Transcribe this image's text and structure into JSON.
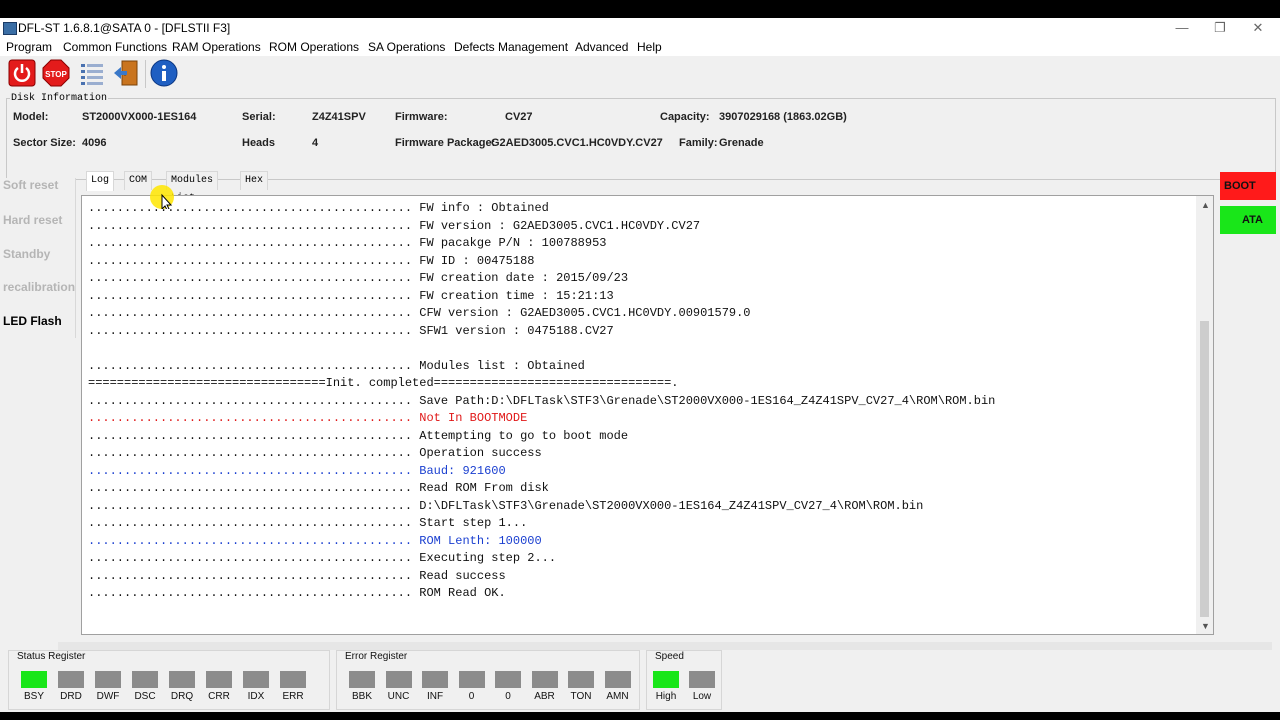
{
  "window": {
    "title": "DFL-ST 1.6.8.1@SATA 0 - [DFLSTII  F3]",
    "controls": {
      "minimize": "—",
      "restore": "❐",
      "close": "✕"
    }
  },
  "menu": [
    "Program",
    "Common Functions",
    "RAM Operations",
    "ROM Operations",
    "SA Operations",
    "Defects Management",
    "Advanced",
    "Help"
  ],
  "toolbar": {
    "icons": [
      "power-icon",
      "stop-icon",
      "list-icon",
      "exit-door-icon",
      "info-icon"
    ],
    "stop_text": "STOP"
  },
  "disk_info": {
    "legend": "Disk Information",
    "model_label": "Model:",
    "model_value": "ST2000VX000-1ES164",
    "serial_label": "Serial:",
    "serial_value": "Z4Z41SPV",
    "firmware_label": "Firmware:",
    "firmware_value": "CV27",
    "capacity_label": "Capacity:",
    "capacity_value": "3907029168 (1863.02GB)",
    "sector_label": "Sector Size:",
    "sector_value": "4096",
    "heads_label": "Heads",
    "heads_value": "4",
    "package_label": "Firmware Package:",
    "package_value": "G2AED3005.CVC1.HC0VDY.CV27",
    "family_label": "Family:",
    "family_value": "Grenade"
  },
  "left_panel": [
    {
      "label": "Soft reset",
      "enabled": false
    },
    {
      "label": "Hard reset",
      "enabled": false
    },
    {
      "label": "Standby",
      "enabled": false
    },
    {
      "label": "recalibration",
      "enabled": false
    },
    {
      "label": "LED Flash",
      "enabled": true
    }
  ],
  "tabs": [
    "Log",
    "COM",
    "Modules List",
    "Hex"
  ],
  "active_tab": "Log",
  "log_lines": [
    {
      "text": "............................................. FW info : Obtained",
      "color": "#111111"
    },
    {
      "text": "............................................. FW version : G2AED3005.CVC1.HC0VDY.CV27",
      "color": "#111111"
    },
    {
      "text": "............................................. FW pacakge P/N : 100788953",
      "color": "#111111"
    },
    {
      "text": "............................................. FW ID : 00475188",
      "color": "#111111"
    },
    {
      "text": "............................................. FW creation date : 2015/09/23",
      "color": "#111111"
    },
    {
      "text": "............................................. FW creation time : 15:21:13",
      "color": "#111111"
    },
    {
      "text": "............................................. CFW version : G2AED3005.CVC1.HC0VDY.00901579.0",
      "color": "#111111"
    },
    {
      "text": "............................................. SFW1 version : 0475188.CV27",
      "color": "#111111"
    },
    {
      "text": "",
      "color": "#111111"
    },
    {
      "text": "............................................. Modules list : Obtained",
      "color": "#111111"
    },
    {
      "text": "=================================Init. completed=================================.",
      "color": "#111111"
    },
    {
      "text": "............................................. Save Path:D:\\DFLTask\\STF3\\Grenade\\ST2000VX000-1ES164_Z4Z41SPV_CV27_4\\ROM\\ROM.bin",
      "color": "#111111"
    },
    {
      "text": "............................................. Not In BOOTMODE",
      "color": "#e01818"
    },
    {
      "text": "............................................. Attempting to go to boot mode",
      "color": "#111111"
    },
    {
      "text": "............................................. Operation success",
      "color": "#111111"
    },
    {
      "text": "............................................. Baud: 921600",
      "color": "#1a3fd0"
    },
    {
      "text": "............................................. Read ROM From disk",
      "color": "#111111"
    },
    {
      "text": "............................................. D:\\DFLTask\\STF3\\Grenade\\ST2000VX000-1ES164_Z4Z41SPV_CV27_4\\ROM\\ROM.bin",
      "color": "#111111"
    },
    {
      "text": "............................................. Start step 1...",
      "color": "#111111"
    },
    {
      "text": "............................................. ROM Lenth: 100000",
      "color": "#1a3fd0"
    },
    {
      "text": "............................................. Executing step 2...",
      "color": "#111111"
    },
    {
      "text": "............................................. Read success",
      "color": "#111111"
    },
    {
      "text": "............................................. ROM Read OK.",
      "color": "#111111"
    }
  ],
  "side_buttons": {
    "boot": "BOOT",
    "ata": "ATA"
  },
  "status_register": {
    "title": "Status Register",
    "bits": [
      {
        "label": "BSY",
        "on": true
      },
      {
        "label": "DRD",
        "on": false
      },
      {
        "label": "DWF",
        "on": false
      },
      {
        "label": "DSC",
        "on": false
      },
      {
        "label": "DRQ",
        "on": false
      },
      {
        "label": "CRR",
        "on": false
      },
      {
        "label": "IDX",
        "on": false
      },
      {
        "label": "ERR",
        "on": false
      }
    ]
  },
  "error_register": {
    "title": "Error Register",
    "bits": [
      {
        "label": "BBK",
        "on": false
      },
      {
        "label": "UNC",
        "on": false
      },
      {
        "label": "INF",
        "on": false
      },
      {
        "label": "0",
        "on": false
      },
      {
        "label": "0",
        "on": false
      },
      {
        "label": "ABR",
        "on": false
      },
      {
        "label": "TON",
        "on": false
      },
      {
        "label": "AMN",
        "on": false
      }
    ]
  },
  "speed": {
    "title": "Speed",
    "bits": [
      {
        "label": "High",
        "on": true
      },
      {
        "label": "Low",
        "on": false
      }
    ]
  }
}
